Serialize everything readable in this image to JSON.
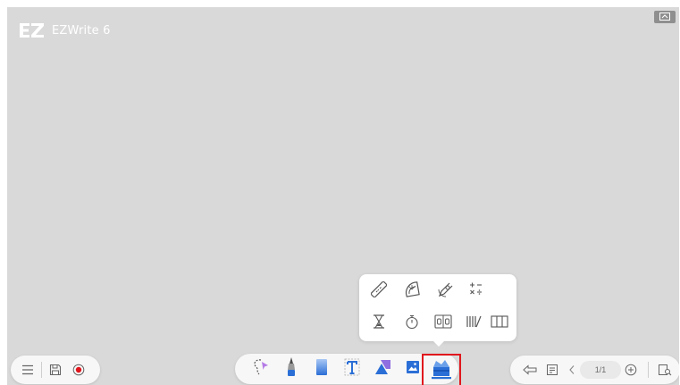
{
  "app": {
    "logo_text": "EZWrite 6",
    "logo_mark": "EZ",
    "accent_color": "#2b6fd6",
    "highlight_color": "#e0161d",
    "canvas_color": "#d9d9d9"
  },
  "top_right": {
    "icon": "display-switch-icon"
  },
  "left_toolbar": {
    "items": [
      {
        "name": "menu",
        "icon": "menu-icon"
      },
      {
        "name": "save",
        "icon": "save-icon"
      },
      {
        "name": "record",
        "icon": "record-icon"
      }
    ]
  },
  "center_toolbar": {
    "tools": [
      {
        "name": "select",
        "icon": "lasso-select-icon"
      },
      {
        "name": "pen",
        "icon": "pen-icon"
      },
      {
        "name": "eraser",
        "icon": "eraser-icon"
      },
      {
        "name": "text",
        "icon": "text-icon"
      },
      {
        "name": "shapes",
        "icon": "shapes-icon"
      },
      {
        "name": "image",
        "icon": "image-icon"
      },
      {
        "name": "toolbox",
        "icon": "toolbox-icon",
        "active": true
      }
    ]
  },
  "toolbox_popup": {
    "row1": [
      "ruler-icon",
      "protractor-icon",
      "compass-icon",
      "calculator-icon"
    ],
    "row2": [
      "hourglass-icon",
      "stopwatch-icon",
      "scoreboard-icon",
      "tally-icon",
      "columns-icon"
    ]
  },
  "right_toolbar": {
    "page_indicator": "1/1",
    "items": [
      "back-icon",
      "page-view-icon",
      "prev-page-icon",
      "add-page-icon",
      "page-overview-icon"
    ]
  }
}
